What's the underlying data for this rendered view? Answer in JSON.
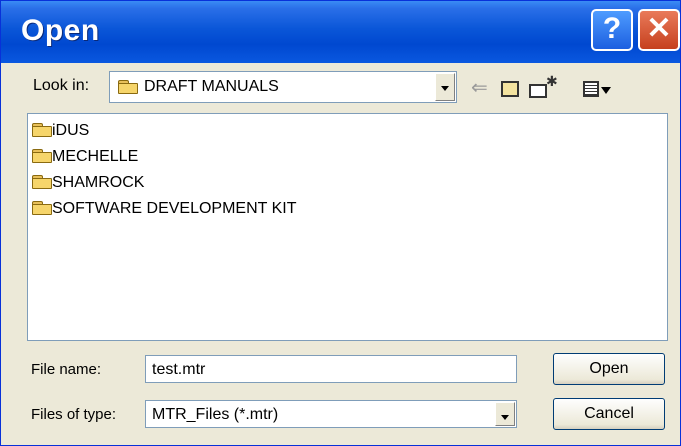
{
  "window": {
    "title": "Open",
    "help_glyph": "?",
    "close_glyph": "✕"
  },
  "toolbar": {
    "look_in_label": "Look in:",
    "look_in_value": "DRAFT MANUALS",
    "icons": [
      "back-arrow-icon",
      "up-one-level-icon",
      "create-new-folder-icon",
      "view-menu-icon"
    ]
  },
  "files": [
    {
      "name": "iDUS",
      "icon": "folder-icon"
    },
    {
      "name": "MECHELLE",
      "icon": "folder-icon"
    },
    {
      "name": "SHAMROCK",
      "icon": "folder-icon"
    },
    {
      "name": "SOFTWARE DEVELOPMENT KIT",
      "icon": "folder-icon"
    }
  ],
  "form": {
    "file_name_label": "File name:",
    "file_name_value": "test.mtr",
    "file_type_label": "Files of type:",
    "file_type_value": "MTR_Files (*.mtr)",
    "open_label": "Open",
    "cancel_label": "Cancel"
  },
  "colors": {
    "titlebar": "#0a56d8",
    "dialog_bg": "#ece9d8",
    "close": "#c6401e"
  }
}
